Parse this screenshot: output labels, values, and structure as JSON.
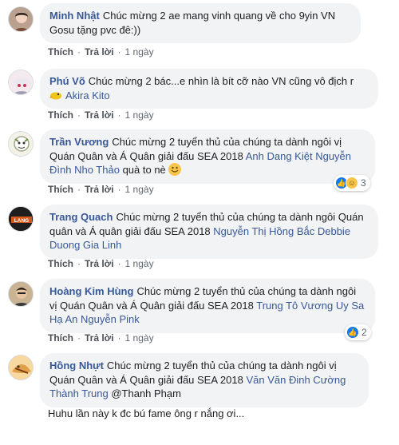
{
  "actions": {
    "like": "Thích",
    "reply": "Trả lời",
    "dot": "·"
  },
  "comments": [
    {
      "author": "Minh Nhật",
      "text": "Chúc mừng 2 ae mang vinh quang về cho 9yin VN Gosu tặng pvc đê:))",
      "time": "1 ngày"
    },
    {
      "author": "Phú Võ",
      "text": "Chúc mừng 2 bác...e nhìn là bít cỡ nào VN cũng vô địch r",
      "tag": "Akira Kito",
      "time": "1 ngày"
    },
    {
      "author": "Trần Vương",
      "text": "Chúc mừng 2 tuyển thủ của chúng ta dành ngôi vị Quán Quân và Á Quân giải đấu SEA 2018",
      "tag": "Anh Dang Kiệt Nguyễn Đình Nho Thảo",
      "suffix": "quà to nè",
      "time": "1 ngày",
      "react_count": "3"
    },
    {
      "author": "Trang Quach",
      "text": "Chúc mừng 2 tuyển thủ của chúng ta dành ngôi Quán quân và Á quân giải đấu SEA 2018",
      "tag": "Nguyễn Thị Hồng Bắc Debbie Duong Gia Linh",
      "time": "1 ngày"
    },
    {
      "author": "Hoàng Kim Hùng",
      "text": "Chúc mừng 2 tuyển thủ của chúng ta dành ngôi vị Quán Quân và Á Quân giải đấu SEA 2018",
      "tag": "Trung Tô Vương Uy Sa Hạ An Nguyễn Pink",
      "time": "1 ngày",
      "react_count": "2"
    },
    {
      "author": "Hồng Nhựt",
      "text": "Chúc mừng 2 tuyển thủ của chúng ta dành ngôi vị Quán Quân và Á Quân giải đấu SEA 2018",
      "tag": "Văn Văn Đinh Cường Thành Trung",
      "suffix": "@Thanh Phạm"
    },
    {
      "reply": "Huhu lần này k đc bú fame ông r nắng ơi..."
    }
  ],
  "avatar_badge": "LANG",
  "colors": {
    "link": "#385898",
    "bubble": "#f2f3f5",
    "meta": "#606770",
    "like": "#1877f2"
  }
}
